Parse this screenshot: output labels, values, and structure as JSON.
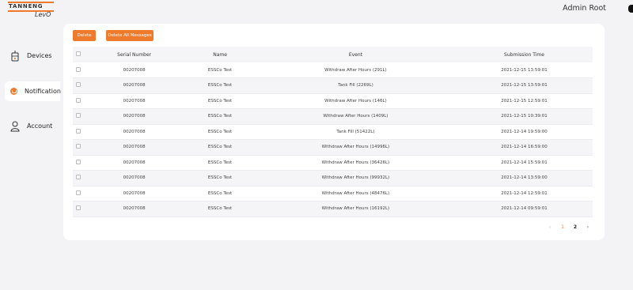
{
  "brand": {
    "name": "TANNENG",
    "product": "LevO"
  },
  "user": {
    "name": "Admin Root"
  },
  "nav": [
    {
      "label": "Devices",
      "icon": "tank-icon"
    },
    {
      "label": "Notification",
      "icon": "bell-icon",
      "active": true
    },
    {
      "label": "Account",
      "icon": "user-icon"
    }
  ],
  "toolbar": {
    "delete_label": "Delete",
    "delete_all_label": "Delete All Messages"
  },
  "table": {
    "columns": [
      "Serial Number",
      "Name",
      "Event",
      "Submission Time"
    ],
    "rows": [
      [
        "00207008",
        "ESSCo Test",
        "Withdraw After Hours (291L)",
        "2021-12-15 13:59:01"
      ],
      [
        "00207008",
        "ESSCo Test",
        "Tank Fill (2269L)",
        "2021-12-15 13:59:01"
      ],
      [
        "00207008",
        "ESSCo Test",
        "Withdraw After Hours (146L)",
        "2021-12-15 12:59:01"
      ],
      [
        "00207008",
        "ESSCo Test",
        "Withdraw After Hours (1409L)",
        "2021-12-15 10:39:01"
      ],
      [
        "00207008",
        "ESSCo Test",
        "Tank Fill (51422L)",
        "2021-12-14 19:59:00"
      ],
      [
        "00207008",
        "ESSCo Test",
        "Withdraw After Hours (14996L)",
        "2021-12-14 16:59:00"
      ],
      [
        "00207008",
        "ESSCo Test",
        "Withdraw After Hours (36426L)",
        "2021-12-14 15:59:01"
      ],
      [
        "00207008",
        "ESSCo Test",
        "Withdraw After Hours (99932L)",
        "2021-12-14 13:59:00"
      ],
      [
        "00207008",
        "ESSCo Test",
        "Withdraw After Hours (48476L)",
        "2021-12-14 12:59:01"
      ],
      [
        "00207008",
        "ESSCo Test",
        "Withdraw After Hours (16192L)",
        "2021-12-14 09:59:01"
      ]
    ]
  },
  "pagination": {
    "prev": "‹",
    "pages": [
      "1",
      "2"
    ],
    "current": "1",
    "next": "›"
  },
  "colors": {
    "accent": "#f07a2b",
    "background": "#f3f3f6"
  }
}
